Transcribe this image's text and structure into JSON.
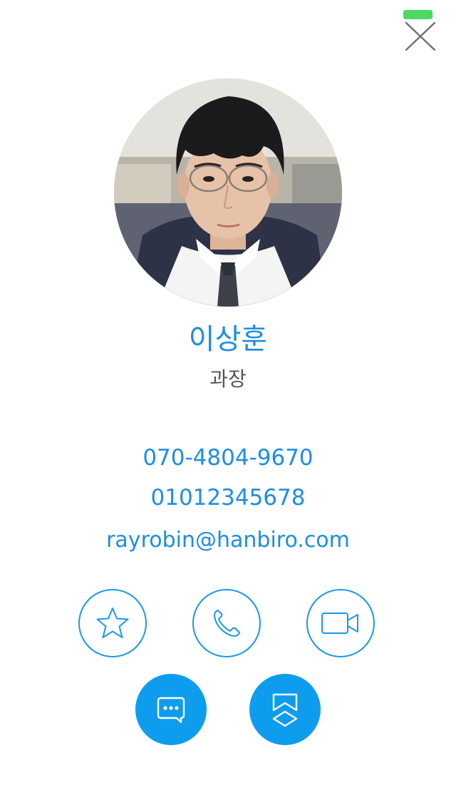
{
  "contact": {
    "name": "이상훈",
    "title": "과장",
    "phone_office": "070-4804-9670",
    "phone_mobile": "01012345678",
    "email": "rayrobin@hanbiro.com"
  },
  "actions": {
    "favorite_icon": "star-icon",
    "call_icon": "phone-icon",
    "video_icon": "video-camera-icon",
    "chat_icon": "chat-bubble-icon",
    "org_icon": "org-chart-icon"
  },
  "colors": {
    "accent": "#1a8fe3",
    "filled_button": "#0e9cee",
    "status_indicator": "#4cd964",
    "title_text": "#555555"
  }
}
